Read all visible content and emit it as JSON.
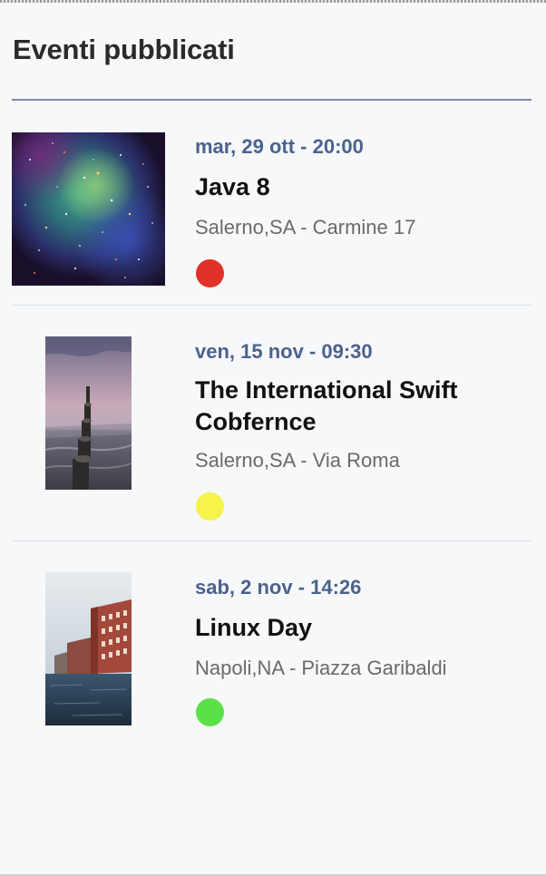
{
  "header": {
    "title": "Eventi pubblicati"
  },
  "colors": {
    "accent_date": "#4b628d",
    "divider": "#7c8aa6"
  },
  "events": [
    {
      "date": "mar, 29 ott - 20:00",
      "title": "Java 8",
      "location": "Salerno,SA - Carmine 17",
      "status_color": "#e0322a",
      "image": "galaxy-nebula"
    },
    {
      "date": "ven, 15 nov - 09:30",
      "title": "The International Swift Cobfernce",
      "location": "Salerno,SA - Via Roma",
      "status_color": "#f6f34a",
      "image": "seaside-pier"
    },
    {
      "date": "sab, 2 nov - 14:26",
      "title": "Linux Day",
      "location": "Napoli,NA - Piazza Garibaldi",
      "status_color": "#5ce04a",
      "image": "waterfront-buildings"
    }
  ]
}
